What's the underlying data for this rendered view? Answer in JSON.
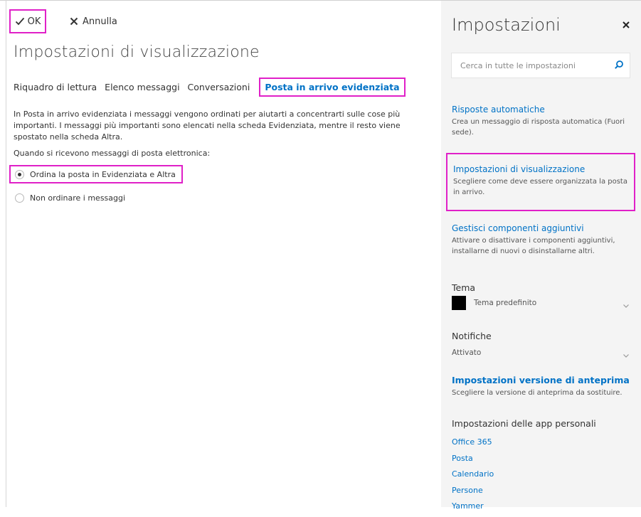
{
  "toolbar": {
    "ok_label": "OK",
    "cancel_label": "Annulla"
  },
  "main": {
    "title": "Impostazioni di visualizzazione",
    "tabs": [
      {
        "label": "Riquadro di lettura"
      },
      {
        "label": "Elenco messaggi"
      },
      {
        "label": "Conversazioni"
      },
      {
        "label": "Posta in arrivo evidenziata",
        "active": true
      }
    ],
    "description": "In Posta in arrivo evidenziata i messaggi vengono ordinati per aiutarti a concentrarti sulle cose più importanti. I messaggi più importanti sono elencati nella scheda Evidenziata, mentre il resto viene spostato nella scheda Altra.",
    "question": "Quando si ricevono messaggi di posta elettronica:",
    "options": [
      {
        "label": "Ordina la posta in Evidenziata e Altra",
        "selected": true
      },
      {
        "label": "Non ordinare i messaggi",
        "selected": false
      }
    ]
  },
  "settings": {
    "title": "Impostazioni",
    "search_placeholder": "Cerca in tutte le impostazioni",
    "items": [
      {
        "title": "Risposte automatiche",
        "description": "Crea un messaggio di risposta automatica (Fuori sede)."
      },
      {
        "title": "Impostazioni di visualizzazione",
        "description": "Scegliere come deve essere organizzata la posta in arrivo."
      },
      {
        "title": "Gestisci componenti aggiuntivi",
        "description": "Attivare o disattivare i componenti aggiuntivi, installarne di nuovi o disinstallarne altri."
      }
    ],
    "theme": {
      "label": "Tema",
      "value": "Tema predefinito",
      "swatch_color": "#000000"
    },
    "notifications": {
      "label": "Notifiche",
      "value": "Attivato"
    },
    "preview": {
      "title": "Impostazioni versione di anteprima",
      "description": "Scegliere la versione di anteprima da sostituire."
    },
    "apps_label": "Impostazioni delle app personali",
    "apps": [
      "Office 365",
      "Posta",
      "Calendario",
      "Persone",
      "Yammer"
    ]
  },
  "colors": {
    "accent": "#0072c6",
    "highlight": "#e020c8",
    "pane_bg": "#f4f4f4"
  }
}
